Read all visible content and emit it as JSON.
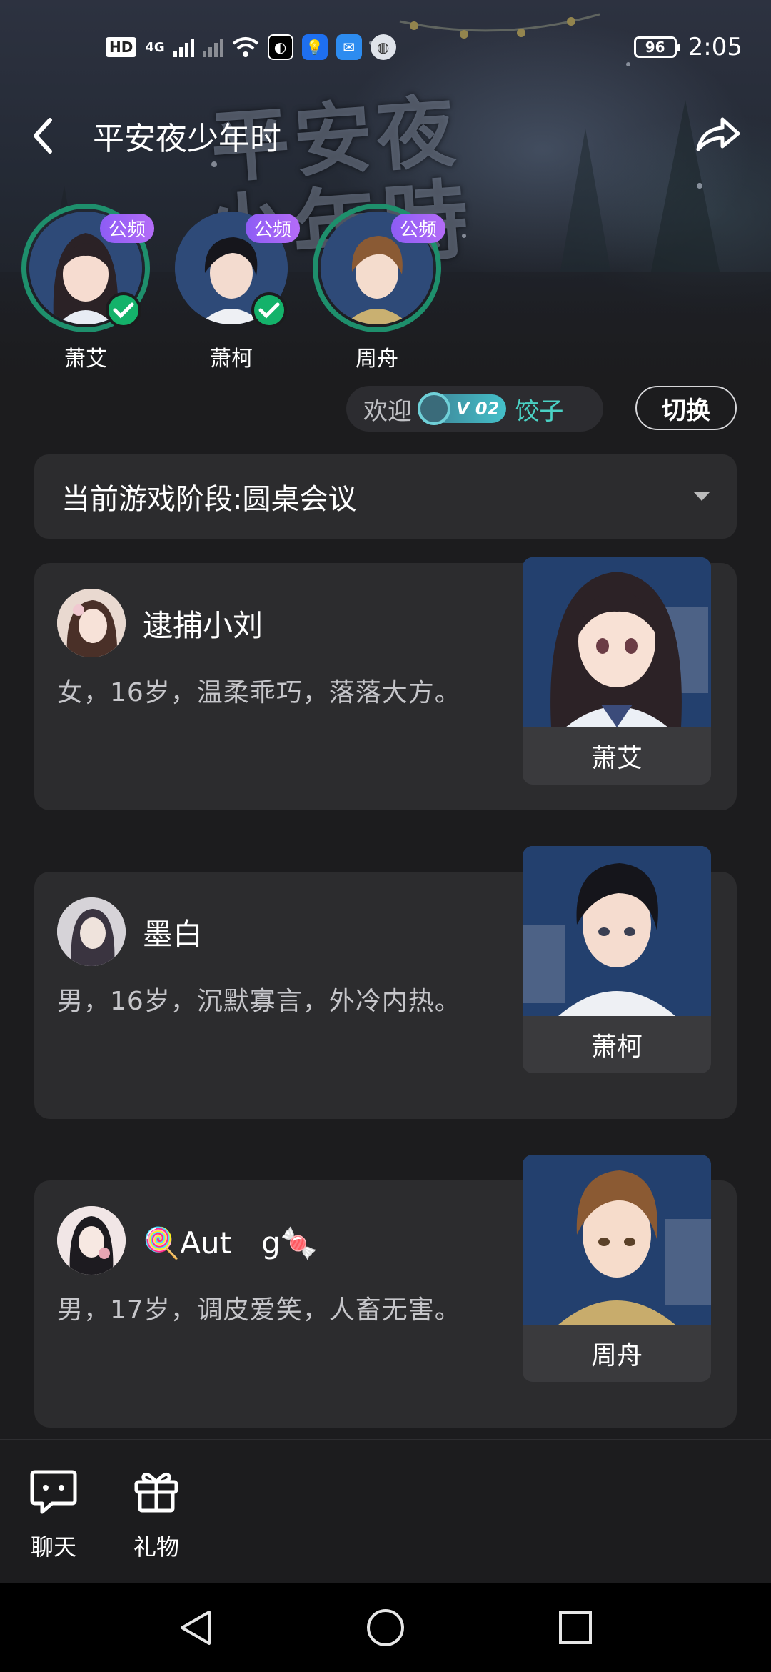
{
  "status": {
    "hd": "HD",
    "net": "4G",
    "battery": "96",
    "time": "2:05"
  },
  "header": {
    "title": "平安夜少年时",
    "banner_logo_line1": "平安夜",
    "banner_logo_line2": "少年時"
  },
  "voice_seats": [
    {
      "name": "萧艾",
      "tag": "公频",
      "active": true,
      "checked": true
    },
    {
      "name": "萧柯",
      "tag": "公频",
      "active": false,
      "checked": true
    },
    {
      "name": "周舟",
      "tag": "公频",
      "active": true,
      "checked": false
    }
  ],
  "welcome": {
    "label": "欢迎",
    "vip_level": "V 02",
    "user": "饺子",
    "switch_label": "切换"
  },
  "phase": {
    "label": "当前游戏阶段:",
    "value": "圆桌会议"
  },
  "roles": [
    {
      "player": "逮捕小刘",
      "desc": "女，16岁，温柔乖巧，落落大方。",
      "role_name": "萧艾"
    },
    {
      "player": "墨白",
      "desc": "男，16岁，沉默寡言，外冷内热。",
      "role_name": "萧柯"
    },
    {
      "player": "🍭Aut　g🍬",
      "desc": "男，17岁，调皮爱笑，人畜无害。",
      "role_name": "周舟"
    }
  ],
  "tools": [
    {
      "label": "聊天",
      "icon": "chat-icon"
    },
    {
      "label": "礼物",
      "icon": "gift-icon"
    }
  ],
  "colors": {
    "background": "#1c1c1e",
    "card": "#2c2c2e",
    "accent_green": "#1e8f6c",
    "check_green": "#14b26a",
    "tag_purple": "#9a62f6",
    "username_cyan": "#4ad1c4"
  }
}
